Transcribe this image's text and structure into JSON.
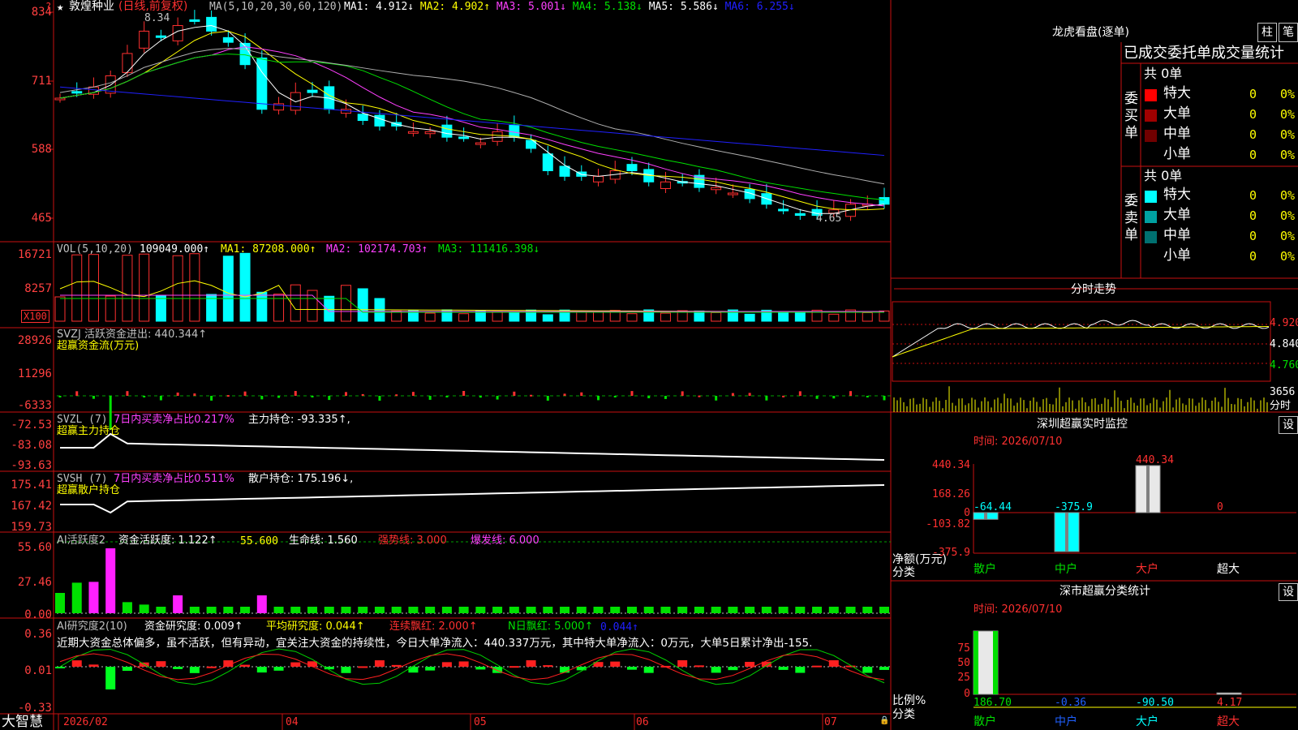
{
  "stock": {
    "name": "敦煌种业",
    "period": "(日线,前复权)",
    "star": "★",
    "mark": "?",
    "high_label": "8.34",
    "low_label": "4.65"
  },
  "ma_line": {
    "label": "MA(5,10,20,30,60,120)",
    "items": [
      {
        "t": "MA1: 4.912↓",
        "c": "#ffffff"
      },
      {
        "t": "MA2: 4.902↑",
        "c": "#ffff00"
      },
      {
        "t": "MA3: 5.001↓",
        "c": "#ff40ff"
      },
      {
        "t": "MA4: 5.138↓",
        "c": "#00e000"
      },
      {
        "t": "MA5: 5.586↓",
        "c": "#ffffff"
      },
      {
        "t": "MA6: 6.255↓",
        "c": "#2020ff"
      }
    ]
  },
  "price_axis": [
    "834",
    "711",
    "588",
    "465"
  ],
  "vol": {
    "head": "VOL(5,10,20)",
    "value": "109049.000↑",
    "ma1": "MA1: 87208.000↑",
    "ma2": "MA2: 102174.703↑",
    "ma3": "MA3: 111416.398↓",
    "axis": [
      "16721",
      "8257"
    ],
    "unit": "X100"
  },
  "svzj": {
    "head": "SVZJ  活跃资金进出: 440.344↑",
    "sub": "超赢资金流(万元)",
    "axis": [
      "28926",
      "11296",
      "-6333"
    ]
  },
  "svzl": {
    "head": "SVZL (7)",
    "ratio": "7日内买卖净占比0.217%",
    "hold": "主力持仓: -93.335↑,",
    "sub": "超赢主力持仓",
    "axis": [
      "-72.53",
      "-83.08",
      "-93.63"
    ]
  },
  "svsh": {
    "head": "SVSH (7)",
    "ratio": "7日内买卖净占比0.511%",
    "hold": "散户持仓: 175.196↓,",
    "sub": "超赢散户持仓",
    "axis": [
      "175.41",
      "167.42",
      "159.73"
    ]
  },
  "ai_active": {
    "head": "AI活跃度2",
    "v1": "资金活跃度: 1.122↑",
    "v2": "55.600",
    "v3": "生命线: 1.560",
    "v4": "强势线: 3.000",
    "v5": "爆发线: 6.000",
    "axis": [
      "55.60",
      "27.46",
      "0.00"
    ]
  },
  "ai_research": {
    "head": "AI研究度2(10)",
    "v1": "资金研究度: 0.009↑",
    "v2": "平均研究度: 0.044↑",
    "v3": "连续飘红: 2.000↑",
    "v4": "N日飘红: 5.000↑",
    "v5": "0.044↑",
    "note": "近期大资金总体偏多，虽不活跃，但有异动，宜关注大资金的持续性，今日大单净流入：440.337万元，其中特大单净流入：0万元，大单5日累计净出-155.",
    "axis": [
      "0.36",
      "0.01",
      "-0.33"
    ]
  },
  "bottom": {
    "brand": "大智慧",
    "dates": [
      "2026/02",
      "04",
      "05",
      "06",
      "07"
    ]
  },
  "right": {
    "title": "龙虎看盘(逐单)",
    "btn1": "柱",
    "btn2": "笔",
    "stats_title": "已成交委托单成交量统计",
    "buy_label": "委买单",
    "sell_label": "委卖单",
    "buy_total": "共 0单",
    "sell_total": "共 0单",
    "buy_rows": [
      {
        "name": "特大",
        "val": "0",
        "pct": "0%",
        "color": "#ff0000"
      },
      {
        "name": "大单",
        "val": "0",
        "pct": "0%",
        "color": "#a00000"
      },
      {
        "name": "中单",
        "val": "0",
        "pct": "0%",
        "color": "#700000"
      },
      {
        "name": "小单",
        "val": "0",
        "pct": "0%",
        "color": ""
      }
    ],
    "sell_rows": [
      {
        "name": "特大",
        "val": "0",
        "pct": "0%",
        "color": "#00ffff"
      },
      {
        "name": "大单",
        "val": "0",
        "pct": "0%",
        "color": "#00a0a0"
      },
      {
        "name": "中单",
        "val": "0",
        "pct": "0%",
        "color": "#007070"
      },
      {
        "name": "小单",
        "val": "0",
        "pct": "0%",
        "color": ""
      }
    ],
    "intraday_title": "分时走势",
    "intraday_axis": [
      "4.920",
      "4.840",
      "4.760"
    ],
    "intraday_vol": "3656",
    "intraday_unit": "分时",
    "sz_title": "深圳超赢实时监控",
    "set": "设",
    "sz_time": "时间: 2026/07/10",
    "sz_axis": [
      "440.34",
      "168.26",
      "0",
      "-103.82",
      "-375.9"
    ],
    "sz_ylabel": "净额(万元)",
    "sz_xlabel": "分类",
    "sz_bars": [
      {
        "cat": "散户",
        "value": -64.44,
        "label": "-64.44"
      },
      {
        "cat": "中户",
        "value": -375.9,
        "label": "-375.9"
      },
      {
        "cat": "大户",
        "value": 440.34,
        "label": "440.34"
      },
      {
        "cat": "超大",
        "value": 0,
        "label": "0"
      }
    ],
    "cls_title": "深市超赢分类统计",
    "cls_time": "时间: 2026/07/10",
    "cls_axis": [
      "75",
      "50",
      "25",
      "0"
    ],
    "cls_ylabel": "比例%",
    "cls_xlabel": "分类",
    "cls_bars": [
      {
        "cat": "散户",
        "value": 186.7,
        "label": "186.70"
      },
      {
        "cat": "中户",
        "value": -0.36,
        "label": "-0.36"
      },
      {
        "cat": "大户",
        "value": -90.5,
        "label": "-90.50"
      },
      {
        "cat": "超大",
        "value": 4.17,
        "label": "4.17"
      }
    ]
  },
  "chart_data": [
    {
      "type": "candlestick",
      "title": "敦煌种业(日线,前复权)",
      "ylim": [
        4.5,
        8.4
      ],
      "x_labels": [
        "2026/02",
        "04",
        "05",
        "06",
        "07"
      ],
      "close_approx": [
        6.8,
        6.9,
        7.0,
        7.2,
        7.6,
        8.0,
        7.9,
        8.1,
        8.2,
        8.0,
        7.8,
        7.4,
        6.6,
        6.7,
        6.9,
        6.9,
        6.6,
        6.6,
        6.4,
        6.3,
        6.3,
        6.2,
        6.2,
        6.1,
        6.1,
        6.0,
        6.2,
        6.1,
        5.9,
        5.5,
        5.4,
        5.4,
        5.4,
        5.5,
        5.5,
        5.3,
        5.3,
        5.3,
        5.2,
        5.2,
        5.1,
        5.0,
        4.9,
        4.8,
        4.7,
        4.7,
        4.8,
        4.9,
        4.9,
        4.9
      ],
      "high": 8.34,
      "low": 4.65
    },
    {
      "type": "bar",
      "title": "VOL(5,10,20)",
      "values_note": "volume bars",
      "last": 109049.0
    }
  ]
}
